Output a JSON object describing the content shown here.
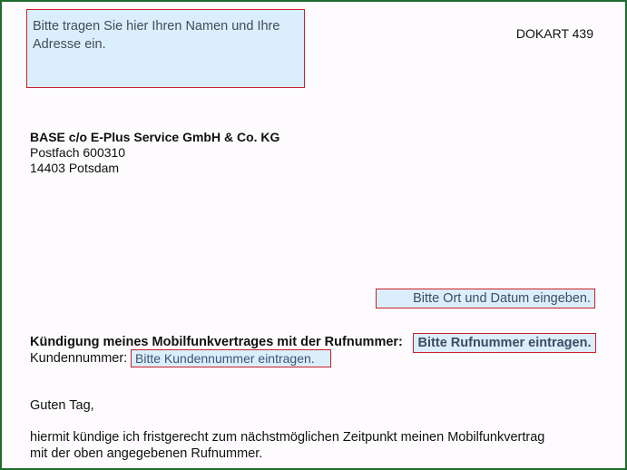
{
  "document": {
    "code": "DOKART 439",
    "sender_placeholder": "Bitte tragen Sie hier Ihren Namen und Ihre Adresse ein.",
    "recipient": {
      "company": "BASE c/o E-Plus Service GmbH & Co. KG",
      "po_box": "Postfach 600310",
      "city": "14403 Potsdam"
    },
    "date_placeholder": "Bitte Ort und Datum eingeben.",
    "subject": {
      "label": "Kündigung meines Mobilfunkvertrages mit der Rufnummer:",
      "phone_placeholder": "Bitte Rufnummer eintragen."
    },
    "customer": {
      "label": "Kundennummer:",
      "placeholder": "Bitte Kundennummer eintragen."
    },
    "greeting": "Guten Tag,",
    "body": {
      "line1": "hiermit kündige ich fristgerecht zum nächstmöglichen Zeitpunkt meinen Mobilfunkvertrag",
      "line2": "mit der oben angegebenen Rufnummer."
    }
  }
}
